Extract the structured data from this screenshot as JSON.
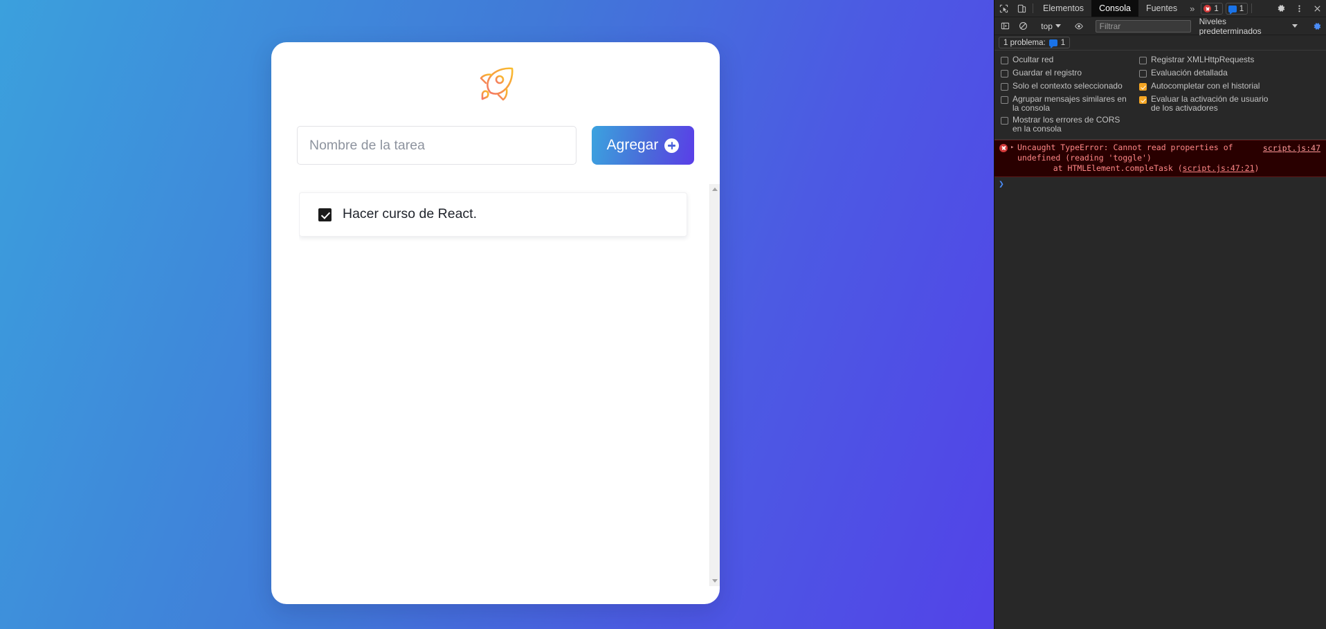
{
  "page": {
    "card": {
      "logo_icon": "rocket-icon",
      "input": {
        "value": "",
        "placeholder": "Nombre de la tarea"
      },
      "add_button": {
        "label": "Agregar",
        "icon": "plus-circle-icon"
      },
      "tasks": [
        {
          "label": "Hacer curso de React.",
          "checked": true
        }
      ],
      "scrollbar": {
        "up_icon": "triangle-up-icon",
        "down_icon": "triangle-down-icon"
      }
    },
    "colors": {
      "bg_gradient_start": "#3ba0dd",
      "bg_gradient_end": "#5243e8",
      "button_gradient_start": "#3ba3df",
      "button_gradient_end": "#5a3ee8",
      "card_bg": "#ffffff",
      "rocket_orange": "#f5a623",
      "rocket_coral": "#f4776a"
    }
  },
  "devtools": {
    "tabbar": {
      "inspect_icon": "inspect-element-icon",
      "device_icon": "device-toolbar-icon",
      "tabs": [
        {
          "label": "Elementos",
          "active": false
        },
        {
          "label": "Consola",
          "active": true
        },
        {
          "label": "Fuentes",
          "active": false
        }
      ],
      "more_tabs_icon": "chevron-double-right-icon",
      "error_count": "1",
      "warning_count": "1",
      "settings_icon": "gear-icon",
      "menu_icon": "kebab-menu-icon",
      "close_icon": "close-icon"
    },
    "filterbar": {
      "sidebar_icon": "console-sidebar-icon",
      "clear_icon": "clear-console-icon",
      "context": "top",
      "eye_icon": "live-expression-icon",
      "filter_placeholder": "Filtrar",
      "filter_value": "",
      "levels": "Niveles predeterminados",
      "settings_icon": "console-settings-gear-icon"
    },
    "problems": {
      "label": "1 problema:",
      "count": "1",
      "icon": "message-badge-icon"
    },
    "settings": [
      {
        "label": "Ocultar red",
        "checked": false
      },
      {
        "label": "Registrar XMLHttpRequests",
        "checked": false
      },
      {
        "label": "Guardar el registro",
        "checked": false
      },
      {
        "label": "Evaluación detallada",
        "checked": false
      },
      {
        "label": "Solo el contexto seleccionado",
        "checked": false
      },
      {
        "label": "Autocompletar con el historial",
        "checked": true
      },
      {
        "label": "Agrupar mensajes similares en la consola",
        "checked": false
      },
      {
        "label": "Evaluar la activación de usuario de los activadores",
        "checked": true
      },
      {
        "label": "Mostrar los errores de CORS en la consola",
        "checked": false
      }
    ],
    "console": {
      "error": {
        "message_line1": "Uncaught TypeError: Cannot read properties of",
        "message_line2": "undefined (reading 'toggle')",
        "stack_prefix": "    at HTMLElement.compleTask (",
        "stack_link": "script.js:47:21",
        "stack_suffix": ")",
        "source_link": "script.js:47",
        "expander": "▸"
      },
      "prompt_caret": "❯",
      "input_value": ""
    }
  }
}
